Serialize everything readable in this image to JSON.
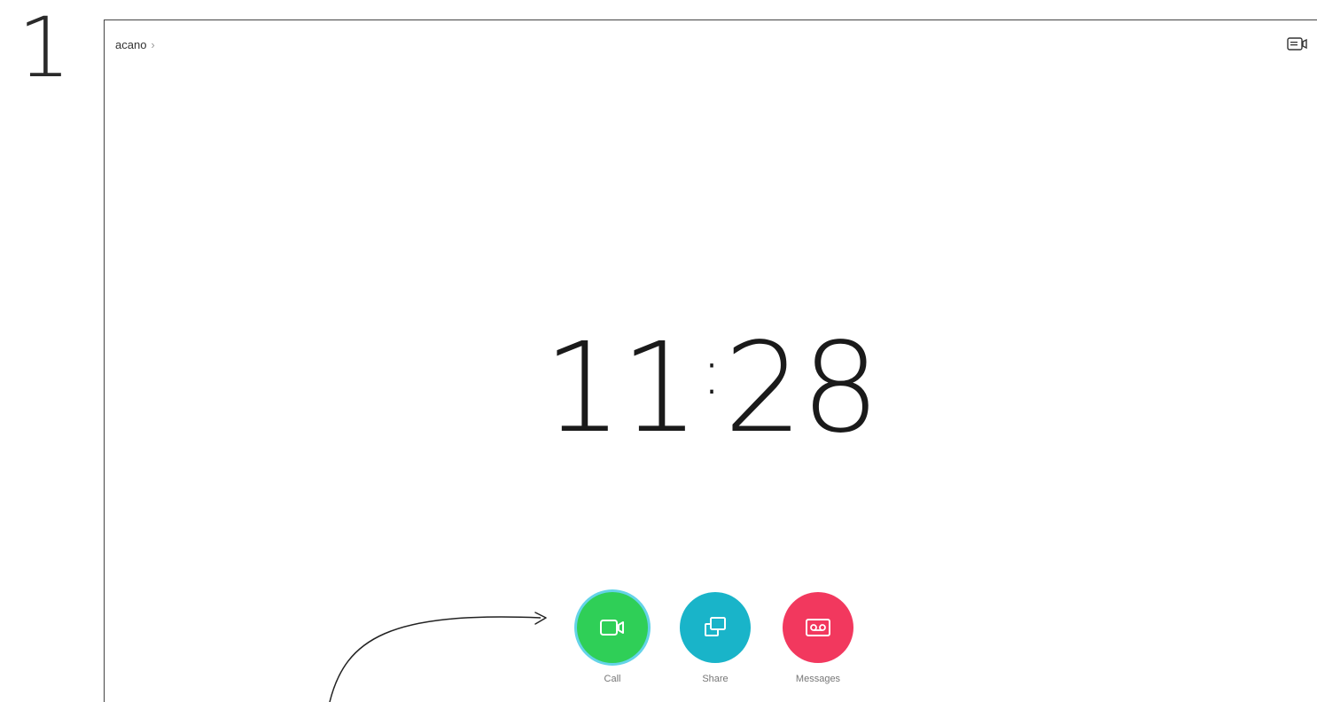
{
  "step": "1",
  "header": {
    "breadcrumb_label": "acano",
    "breadcrumb_chevron": "›",
    "selfview_icon": "selfview-camera-icon"
  },
  "clock": {
    "hours": "11",
    "minutes": "28"
  },
  "actions": [
    {
      "label": "Call",
      "icon": "video-camera-icon",
      "color": "#2fcf57",
      "ring": "#64d3e8"
    },
    {
      "label": "Share",
      "icon": "share-screens-icon",
      "color": "#19b4c9"
    },
    {
      "label": "Messages",
      "icon": "voicemail-icon",
      "color": "#f2385e"
    }
  ]
}
